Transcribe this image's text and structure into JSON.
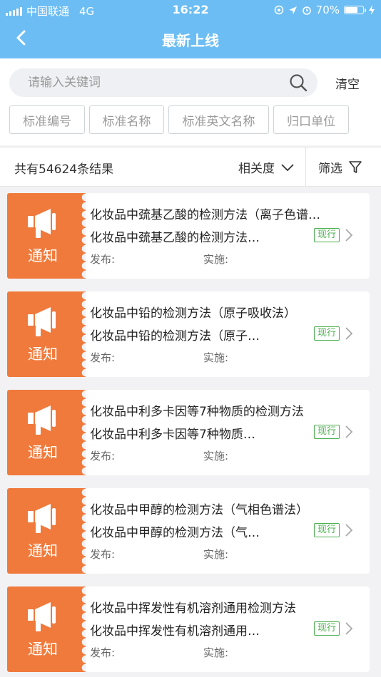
{
  "status_bar": {
    "carrier": "中国联通",
    "network": "4G",
    "time": "16:22",
    "battery": "70%"
  },
  "nav": {
    "title": "最新上线"
  },
  "search": {
    "placeholder": "请输入关键词",
    "clear_label": "清空"
  },
  "filters": [
    "标准编号",
    "标准名称",
    "标准英文名称",
    "归口单位"
  ],
  "results": {
    "count_text": "共有54624条结果",
    "sort_label": "相关度",
    "filter_label": "筛选"
  },
  "items": [
    {
      "tag": "通知",
      "title": "化妆品中巯基乙酸的检测方法（离子色谱…",
      "subtitle": "化妆品中巯基乙酸的检测方法…",
      "status": "现行",
      "publish_label": "发布:",
      "implement_label": "实施:"
    },
    {
      "tag": "通知",
      "title": "化妆品中铅的检测方法（原子吸收法）",
      "subtitle": "化妆品中铅的检测方法（原子…",
      "status": "现行",
      "publish_label": "发布:",
      "implement_label": "实施:"
    },
    {
      "tag": "通知",
      "title": "化妆品中利多卡因等7种物质的检测方法",
      "subtitle": "化妆品中利多卡因等7种物质…",
      "status": "现行",
      "publish_label": "发布:",
      "implement_label": "实施:"
    },
    {
      "tag": "通知",
      "title": "化妆品中甲醇的检测方法（气相色谱法）",
      "subtitle": "化妆品中甲醇的检测方法（气…",
      "status": "现行",
      "publish_label": "发布:",
      "implement_label": "实施:"
    },
    {
      "tag": "通知",
      "title": "化妆品中挥发性有机溶剂通用检测方法",
      "subtitle": "化妆品中挥发性有机溶剂通用…",
      "status": "现行",
      "publish_label": "发布:",
      "implement_label": "实施:"
    }
  ],
  "colors": {
    "header": "#6cbdf3",
    "ticket": "#f07a3c",
    "status_green": "#4caf50"
  }
}
